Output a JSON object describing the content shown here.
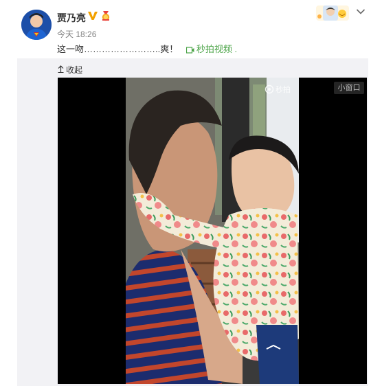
{
  "post": {
    "username": "贾乃亮",
    "time": "今天 18:26",
    "status_text": "这一吻……………………..爽！",
    "link_label": "秒拍视频",
    "link_suffix": " ."
  },
  "media": {
    "collapse_label": "收起",
    "watermark_label": "秒拍",
    "mini_window_label": "小窗口"
  },
  "icons": {
    "verified": "verified-v-icon",
    "medal": "medal-icon",
    "chevron": "chevron-down-icon",
    "video_link": "video-link-icon",
    "collapse_arrow": "collapse-arrow-icon"
  },
  "colors": {
    "link_green": "#4aa346",
    "verified_orange": "#f2a100",
    "panel_bg": "#f2f2f5"
  }
}
